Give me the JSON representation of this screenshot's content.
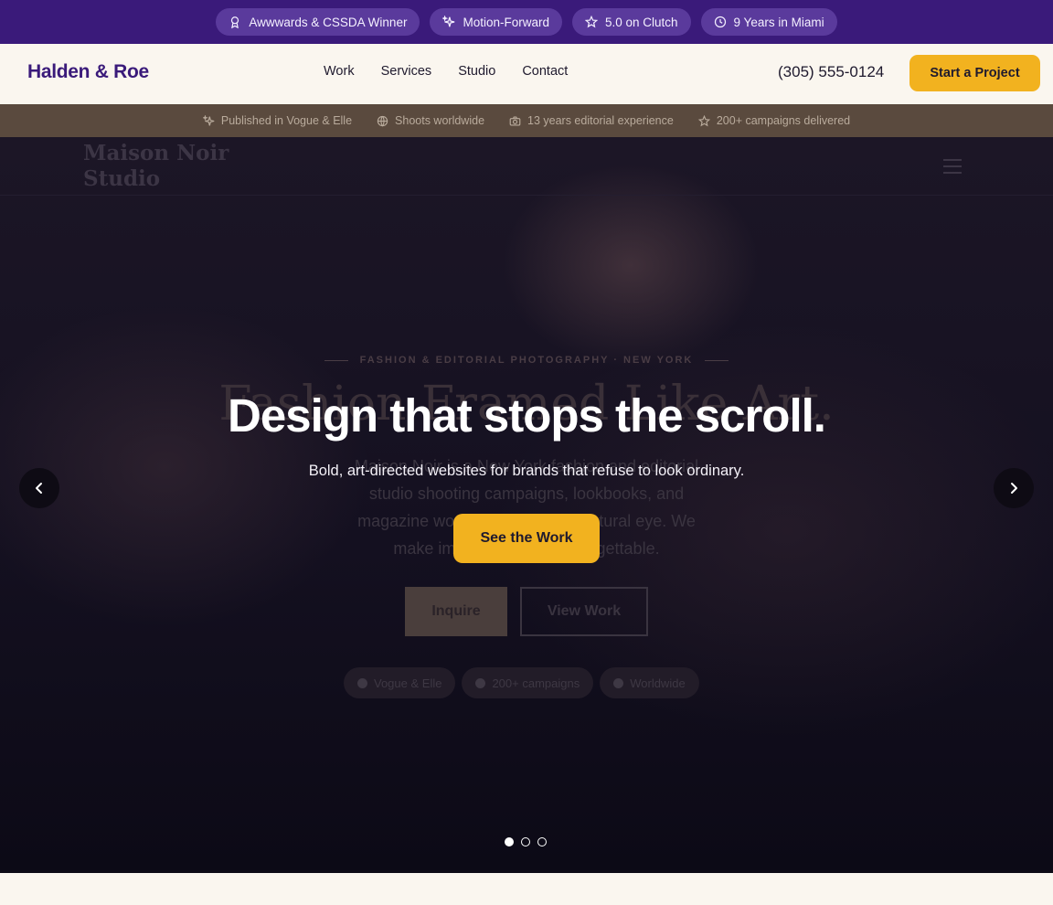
{
  "badges": [
    {
      "icon": "award-icon",
      "label": "Awwwards & CSSDA Winner"
    },
    {
      "icon": "sparkles-icon",
      "label": "Motion-Forward"
    },
    {
      "icon": "star-icon",
      "label": "5.0 on Clutch"
    },
    {
      "icon": "clock-icon",
      "label": "9 Years in Miami"
    }
  ],
  "nav": {
    "brand": "Halden & Roe",
    "links": [
      "Work",
      "Services",
      "Studio",
      "Contact"
    ],
    "phone": "(305) 555-0124",
    "cta": "Start a Project"
  },
  "proof": [
    {
      "icon": "sparkles-icon",
      "label": "Published in Vogue & Elle"
    },
    {
      "icon": "globe-icon",
      "label": "Shoots worldwide"
    },
    {
      "icon": "camera-icon",
      "label": "13 years editorial experience"
    },
    {
      "icon": "star-icon",
      "label": "200+ campaigns delivered"
    }
  ],
  "ghost": {
    "logo_line1": "Maison Noir",
    "logo_line2": "Studio",
    "eyebrow": "FASHION & EDITORIAL PHOTOGRAPHY · NEW YORK",
    "title": "Fashion Framed Like Art.",
    "paragraph": "Maison Noir is a New York fashion and editorial studio shooting campaigns, lookbooks, and magazine work with a bold, sculptural eye. We make images that feel unforgettable.",
    "inquire": "Inquire",
    "view": "View Work",
    "pills": [
      "Vogue & Elle",
      "200+ campaigns",
      "Worldwide"
    ]
  },
  "hero": {
    "title": "Design that stops the scroll.",
    "subtitle": "Bold, art-directed websites for brands that refuse to look ordinary.",
    "cta": "See the Work"
  },
  "carousel": {
    "slides": 3,
    "active": 1
  },
  "colors": {
    "brand_purple": "#3a1a7a",
    "accent_gold": "#f2b21f",
    "cream": "#faf6ef"
  }
}
